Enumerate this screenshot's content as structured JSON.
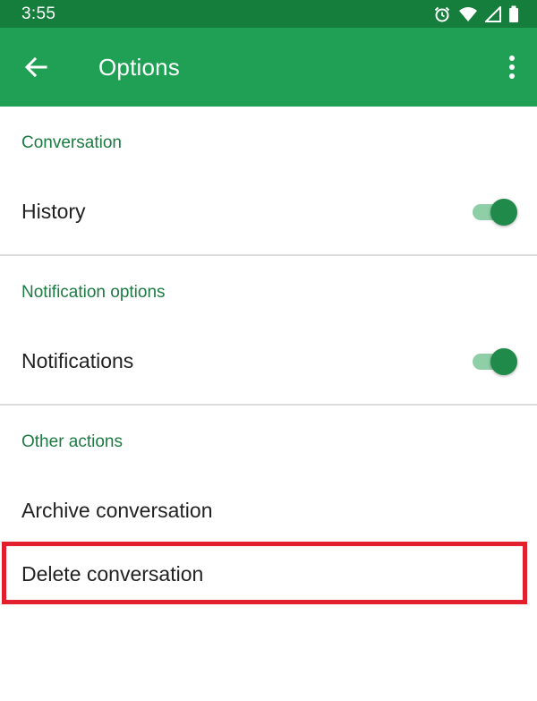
{
  "status_bar": {
    "time": "3:55",
    "icons": [
      "alarm-icon",
      "wifi-icon",
      "signal-icon",
      "battery-icon"
    ]
  },
  "app_bar": {
    "title": "Options",
    "back_icon": "arrow-back-icon",
    "menu_icon": "more-vert-icon"
  },
  "sections": {
    "conversation": {
      "header": "Conversation",
      "history": {
        "label": "History",
        "toggle_on": true
      }
    },
    "notification_options": {
      "header": "Notification options",
      "notifications": {
        "label": "Notifications",
        "toggle_on": true
      }
    },
    "other_actions": {
      "header": "Other actions",
      "archive": {
        "label": "Archive conversation"
      },
      "delete": {
        "label": "Delete conversation",
        "highlighted": true
      }
    }
  },
  "colors": {
    "status_bar": "#157e3c",
    "app_bar": "#1fa055",
    "section_header": "#1c7b42",
    "toggle_thumb": "#1f8a4a",
    "toggle_track": "#8fcfa7",
    "highlight": "#e11f2d"
  }
}
